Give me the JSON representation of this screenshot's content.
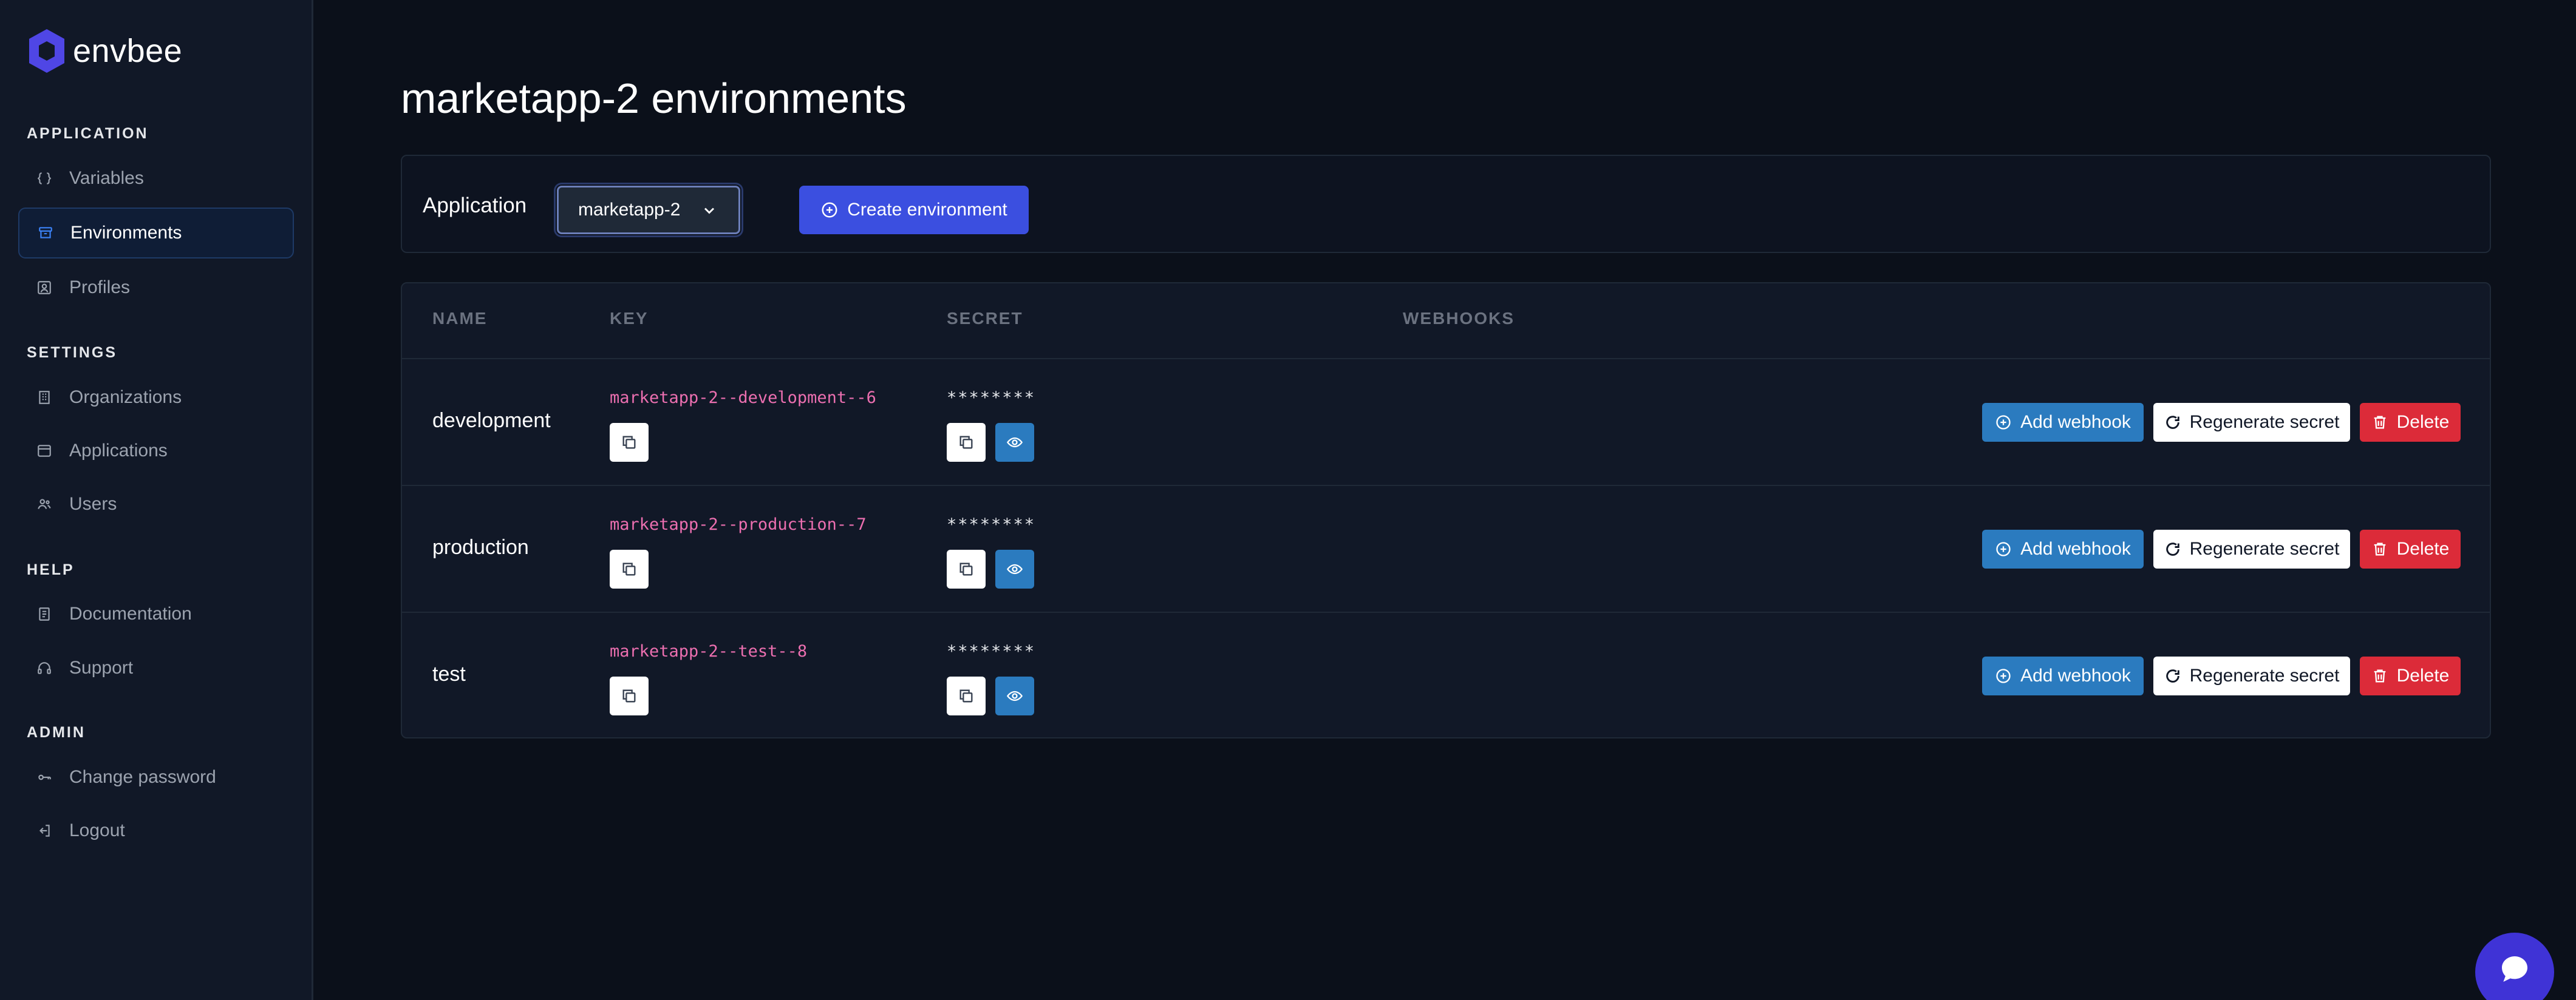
{
  "brand": {
    "name": "envbee",
    "logo_color": "#4f46e5"
  },
  "sidebar": {
    "sections": [
      {
        "label": "APPLICATION",
        "items": [
          {
            "label": "Variables",
            "icon": "braces-icon"
          },
          {
            "label": "Environments",
            "icon": "archive-icon",
            "active": true
          },
          {
            "label": "Profiles",
            "icon": "user-square-icon"
          }
        ]
      },
      {
        "label": "SETTINGS",
        "items": [
          {
            "label": "Organizations",
            "icon": "building-icon"
          },
          {
            "label": "Applications",
            "icon": "window-icon"
          },
          {
            "label": "Users",
            "icon": "users-icon"
          }
        ]
      },
      {
        "label": "HELP",
        "items": [
          {
            "label": "Documentation",
            "icon": "document-icon"
          },
          {
            "label": "Support",
            "icon": "headphones-icon"
          }
        ]
      },
      {
        "label": "ADMIN",
        "items": [
          {
            "label": "Change password",
            "icon": "key-icon"
          },
          {
            "label": "Logout",
            "icon": "logout-icon"
          }
        ]
      }
    ]
  },
  "main": {
    "title": "marketapp-2 environments",
    "filter": {
      "label": "Application",
      "selected": "marketapp-2",
      "create_label": "Create environment"
    },
    "table": {
      "headers": [
        "NAME",
        "KEY",
        "SECRET",
        "WEBHOOKS"
      ],
      "rows": [
        {
          "name": "development",
          "key": "marketapp-2--development--6",
          "secret": "********"
        },
        {
          "name": "production",
          "key": "marketapp-2--production--7",
          "secret": "********"
        },
        {
          "name": "test",
          "key": "marketapp-2--test--8",
          "secret": "********"
        }
      ],
      "actions": {
        "add_webhook": "Add webhook",
        "regenerate": "Regenerate secret",
        "delete": "Delete"
      }
    }
  },
  "colors": {
    "background": "#0b101a",
    "sidebar": "#111827",
    "primary": "#3b4fe0",
    "info": "#2b7bbf",
    "danger": "#dc2b39",
    "key_text": "#ec6fb0"
  }
}
